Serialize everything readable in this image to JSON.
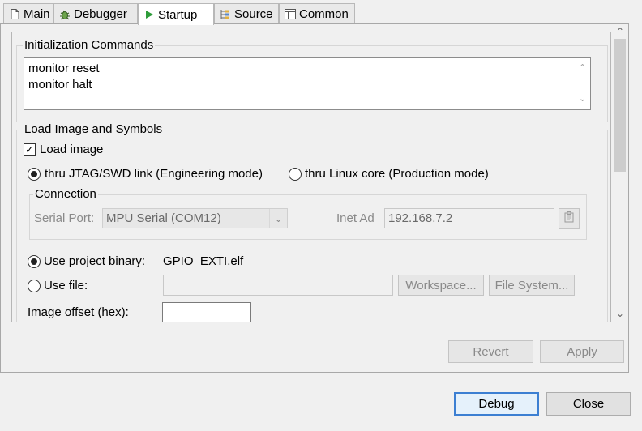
{
  "tabs": [
    {
      "label": "Main",
      "icon": "document-icon"
    },
    {
      "label": "Debugger",
      "icon": "bug-icon"
    },
    {
      "label": "Startup",
      "icon": "play-icon"
    },
    {
      "label": "Source",
      "icon": "source-icon"
    },
    {
      "label": "Common",
      "icon": "common-icon"
    }
  ],
  "init": {
    "group_title": "Initialization Commands",
    "lines": [
      "monitor reset",
      "monitor halt"
    ]
  },
  "load": {
    "group_title": "Load Image and Symbols",
    "load_image_label": "Load image",
    "load_image_checked": true,
    "mode_jtag_label": "thru JTAG/SWD link (Engineering mode)",
    "mode_linux_label": "thru Linux core (Production mode)",
    "connection": {
      "title": "Connection",
      "serial_port_label": "Serial Port:",
      "serial_port_value": "MPU Serial (COM12)",
      "inet_label": "Inet Ad",
      "inet_value": "192.168.7.2"
    },
    "use_project_binary_label": "Use project binary:",
    "project_binary_value": "GPIO_EXTI.elf",
    "use_file_label": "Use file:",
    "use_file_value": "",
    "workspace_button": "Workspace...",
    "filesystem_button": "File System...",
    "image_offset_label": "Image offset (hex):",
    "image_offset_value": ""
  },
  "buttons": {
    "revert": "Revert",
    "apply": "Apply",
    "debug": "Debug",
    "close": "Close"
  },
  "colors": {
    "accent": "#3c7fd2",
    "panel": "#f0f0f0"
  }
}
